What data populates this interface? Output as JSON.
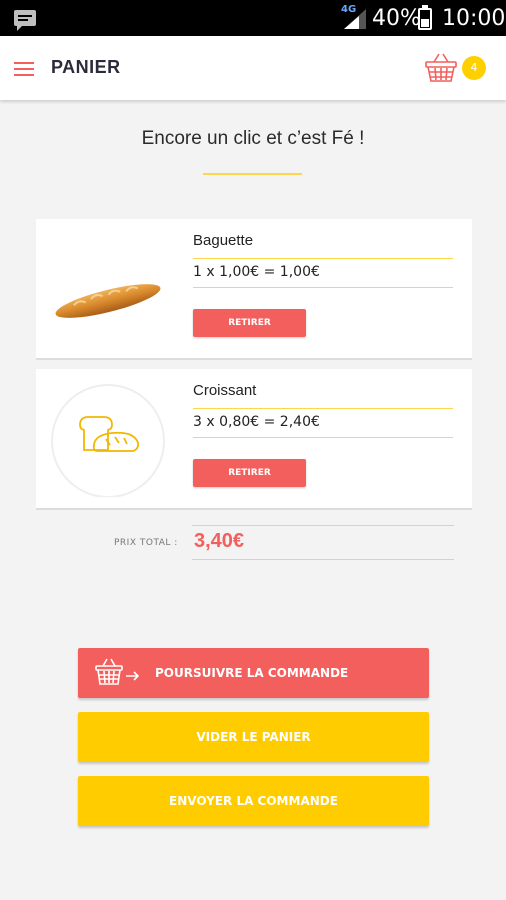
{
  "status_bar": {
    "network": "4G",
    "battery_percent": "40%",
    "time": "10:00"
  },
  "app_bar": {
    "title": "PANIER",
    "cart_count": "4"
  },
  "headline": "Encore un clic et c’est Fé !",
  "cart_items": [
    {
      "name": "Baguette",
      "calc": "1 x 1,00€ = 1,00€",
      "remove_label": "RETIRER",
      "image": "baguette-photo"
    },
    {
      "name": "Croissant",
      "calc": "3 x 0,80€ = 2,40€",
      "remove_label": "RETIRER",
      "image": "bread-icon"
    }
  ],
  "total": {
    "label": "PRIX TOTAL :",
    "value": "3,40€"
  },
  "actions": {
    "continue_label": "POURSUIVRE LA COMMANDE",
    "empty_label": "VIDER LE PANIER",
    "send_label": "ENVOYER LA COMMANDE"
  },
  "colors": {
    "accent_red": "#f25f5c",
    "accent_yellow": "#ffcc00",
    "rule_yellow": "#ffd54d"
  }
}
